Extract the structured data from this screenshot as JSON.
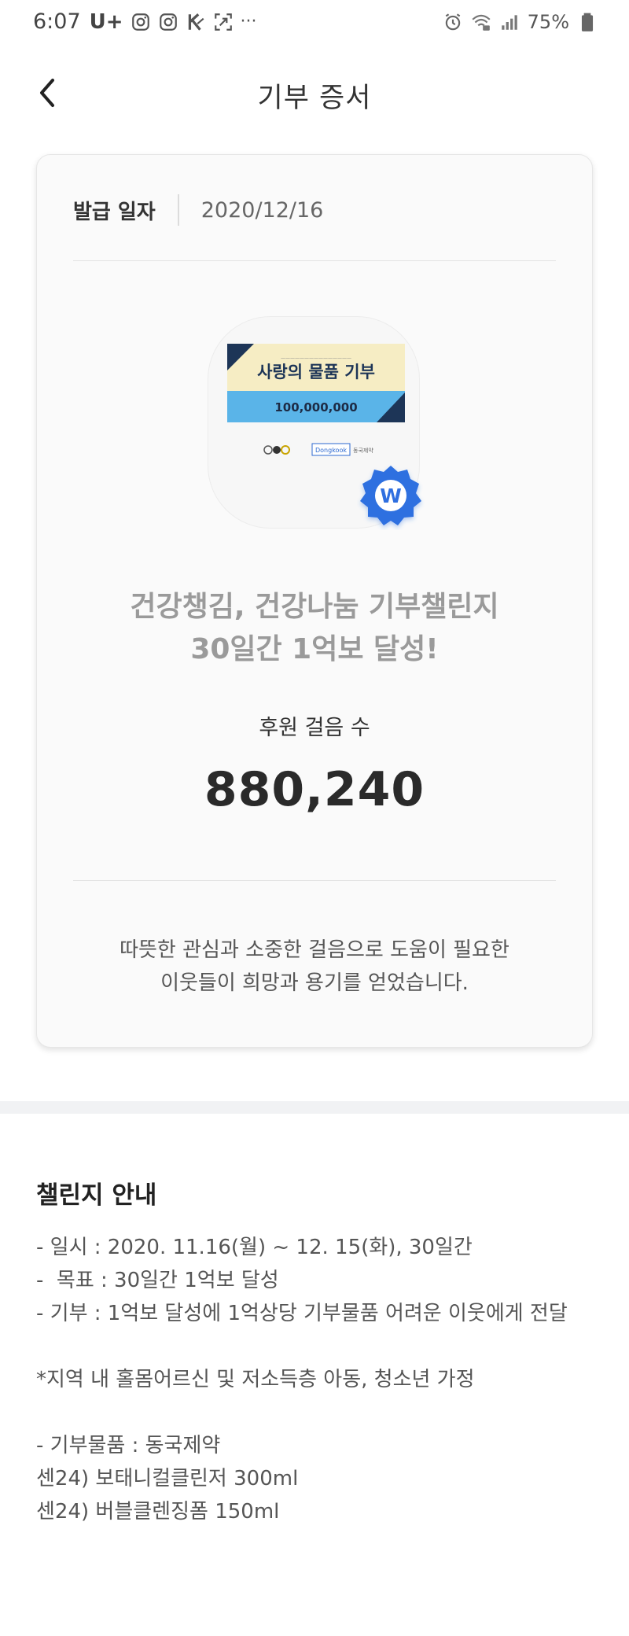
{
  "status_bar": {
    "time": "6:07",
    "carrier": "U+",
    "overflow": "···",
    "battery": "75%",
    "icons_left": [
      "instagram-icon",
      "instagram-icon",
      "k-app-icon",
      "screen-capture-icon"
    ],
    "icons_right": [
      "alarm-icon",
      "wifi-icon",
      "signal-icon",
      "battery-icon"
    ]
  },
  "header": {
    "title": "기부 증서",
    "back_icon": "chevron-left-icon"
  },
  "certificate": {
    "issue_label": "발급 일자",
    "issue_date": "2020/12/16",
    "badge": {
      "banner_title": "사랑의 물품 기부",
      "banner_amount": "100,000,000",
      "sponsor": "Dongkook",
      "w_mark": "W"
    },
    "challenge_title_line1": "건강챙김, 건강나눔 기부챌린지",
    "challenge_title_line2": "30일간 1억보 달성!",
    "steps_label": "후원 걸음 수",
    "steps_value": "880,240",
    "thanks_line1": "따뜻한 관심과 소중한 걸음으로 도움이 필요한",
    "thanks_line2": "이웃들이 희망과 용기를 얻었습니다."
  },
  "challenge_info": {
    "title": "챌린지 안내",
    "lines": [
      "- 일시 : 2020. 11.16(월) ~ 12. 15(화), 30일간",
      "-  목표 : 30일간 1억보 달성",
      "- 기부 : 1억보 달성에 1억상당 기부물품 어려운 이웃에게 전달",
      "*지역 내 홀몸어르신 및 저소득층 아동, 청소년 가정",
      "- 기부물품 : 동국제약",
      "센24) 보태니컬클린저 300ml",
      "센24) 버블클렌징폼 150ml"
    ]
  },
  "colors": {
    "accent_blue": "#2f6fe0",
    "banner_yellow": "#f6edc4",
    "banner_blue": "#5ab4e8",
    "title_gray": "#9a9a9a",
    "band_gray": "#f1f2f4"
  }
}
